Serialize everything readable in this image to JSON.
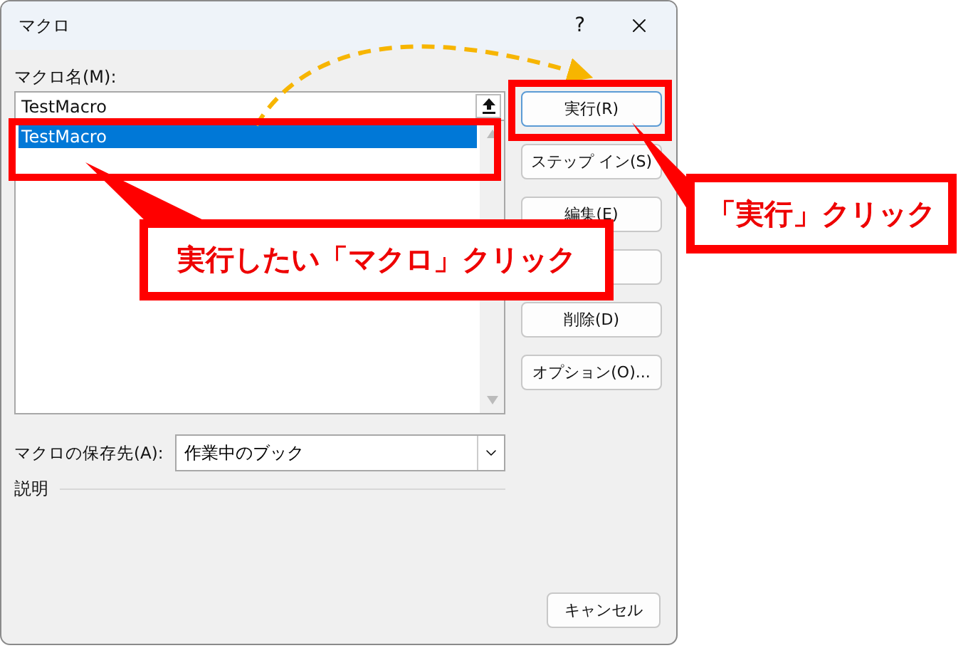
{
  "window": {
    "title": "マクロ",
    "help": "?"
  },
  "macro_name": {
    "label": "マクロ名(M):",
    "value": "TestMacro"
  },
  "macro_list": [
    {
      "name": "TestMacro",
      "selected": true
    }
  ],
  "buttons": [
    {
      "kind": "label",
      "label": "実行(R)",
      "focused": true
    },
    {
      "kind": "label",
      "label": "ステップ イン(S)",
      "focused": false
    },
    {
      "kind": "label",
      "label": "編集(E)",
      "focused": false
    },
    {
      "kind": "covered",
      "focused": false
    },
    {
      "kind": "label",
      "label": "削除(D)",
      "focused": false
    },
    {
      "kind": "label",
      "label": "オプション(O)...",
      "focused": false
    }
  ],
  "storage": {
    "label": "マクロの保存先(A):",
    "value": "作業中のブック"
  },
  "description": {
    "label": "説明"
  },
  "cancel": "キャンセル",
  "callouts": [
    {
      "text": "実行したい「マクロ」クリック"
    },
    {
      "text": "「実行」クリック"
    }
  ]
}
